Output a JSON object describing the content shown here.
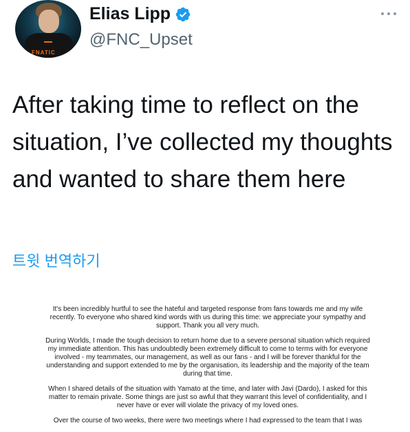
{
  "user": {
    "name": "Elias Lipp",
    "handle": "@FNC_Upset",
    "verified": true,
    "avatar_brand": "FNATIC"
  },
  "tweet": {
    "text": "After taking time to reflect on the situation, I’ve collected my thoughts and wanted to share them here",
    "translate_label": "트윗 번역하기"
  },
  "statement": {
    "paragraphs": [
      "It's been incredibly hurtful to see the hateful and targeted response from fans towards me and my wife recently. To everyone who shared kind words with us during this time: we appreciate your sympathy and support. Thank you all very much.",
      "During Worlds, I made the tough decision to return home due to a severe personal situation which required my immediate attention. This has undoubtedly been extremely difficult to come to terms with for everyone involved - my teammates, our management, as well as our fans - and I will be forever thankful for the understanding and support extended to me by the organisation, its leadership and the majority of the team during that time.",
      "When I shared details of the situation with Yamato at the time, and later with Javi (Dardo), I asked for this matter to remain private. Some things are just so awful that they warrant this level of confidentiality, and I never have or ever will violate the privacy of my loved ones.",
      "Over the course of two weeks, there were two meetings where I had expressed to the team that I was"
    ]
  },
  "colors": {
    "link": "#1d9bf0",
    "secondary_text": "#536471",
    "verified_badge": "#1d9bf0"
  },
  "icons": {
    "verified": "verified-badge-icon",
    "more": "more-options-icon"
  }
}
